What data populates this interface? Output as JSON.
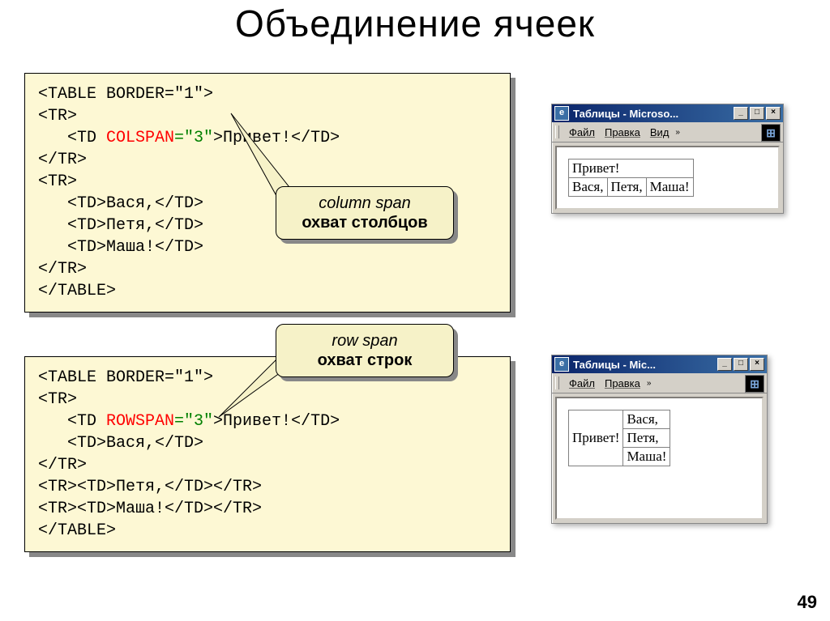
{
  "title": "Объединение ячеек",
  "page_number": "49",
  "code1": [
    {
      "t": "tag",
      "v": "<TABLE BORDER=\"1\">"
    },
    {
      "t": "tag",
      "v": "<TR>"
    },
    {
      "t": "mixed",
      "parts": [
        {
          "t": "tag",
          "v": "   <TD "
        },
        {
          "t": "attr",
          "v": "COLSPAN"
        },
        {
          "t": "val",
          "v": "=\"3\""
        },
        {
          "t": "tag",
          "v": ">Привет!</TD>"
        }
      ]
    },
    {
      "t": "tag",
      "v": "</TR>"
    },
    {
      "t": "tag",
      "v": "<TR>"
    },
    {
      "t": "tag",
      "v": "   <TD>Вася,</TD>"
    },
    {
      "t": "tag",
      "v": "   <TD>Петя,</TD>"
    },
    {
      "t": "tag",
      "v": "   <TD>Маша!</TD>"
    },
    {
      "t": "tag",
      "v": "</TR>"
    },
    {
      "t": "tag",
      "v": "</TABLE>"
    }
  ],
  "code2": [
    {
      "t": "tag",
      "v": "<TABLE BORDER=\"1\">"
    },
    {
      "t": "tag",
      "v": "<TR>"
    },
    {
      "t": "mixed",
      "parts": [
        {
          "t": "tag",
          "v": "   <TD "
        },
        {
          "t": "attr",
          "v": "ROWSPAN"
        },
        {
          "t": "val",
          "v": "=\"3\""
        },
        {
          "t": "tag",
          "v": ">Привет!</TD>"
        }
      ]
    },
    {
      "t": "tag",
      "v": "   <TD>Вася,</TD>"
    },
    {
      "t": "tag",
      "v": "</TR>"
    },
    {
      "t": "tag",
      "v": "<TR><TD>Петя,</TD></TR>"
    },
    {
      "t": "tag",
      "v": "<TR><TD>Маша!</TD></TR>"
    },
    {
      "t": "tag",
      "v": "</TABLE>"
    }
  ],
  "callout1": {
    "line1": "column span",
    "line2": "охват столбцов"
  },
  "callout2": {
    "line1": "row span",
    "line2": "охват строк"
  },
  "browser1": {
    "title": "Таблицы - Microso...",
    "menu": [
      "Файл",
      "Правка",
      "Вид"
    ],
    "table": {
      "row1": [
        "Привет!"
      ],
      "row2": [
        "Вася,",
        "Петя,",
        "Маша!"
      ]
    }
  },
  "browser2": {
    "title": "Таблицы - Mic...",
    "menu": [
      "Файл",
      "Правка"
    ],
    "table": {
      "left": "Привет!",
      "right": [
        "Вася,",
        "Петя,",
        "Маша!"
      ]
    }
  },
  "glyphs": {
    "min": "_",
    "max": "□",
    "close": "×",
    "chev": "»",
    "ie": "e"
  }
}
